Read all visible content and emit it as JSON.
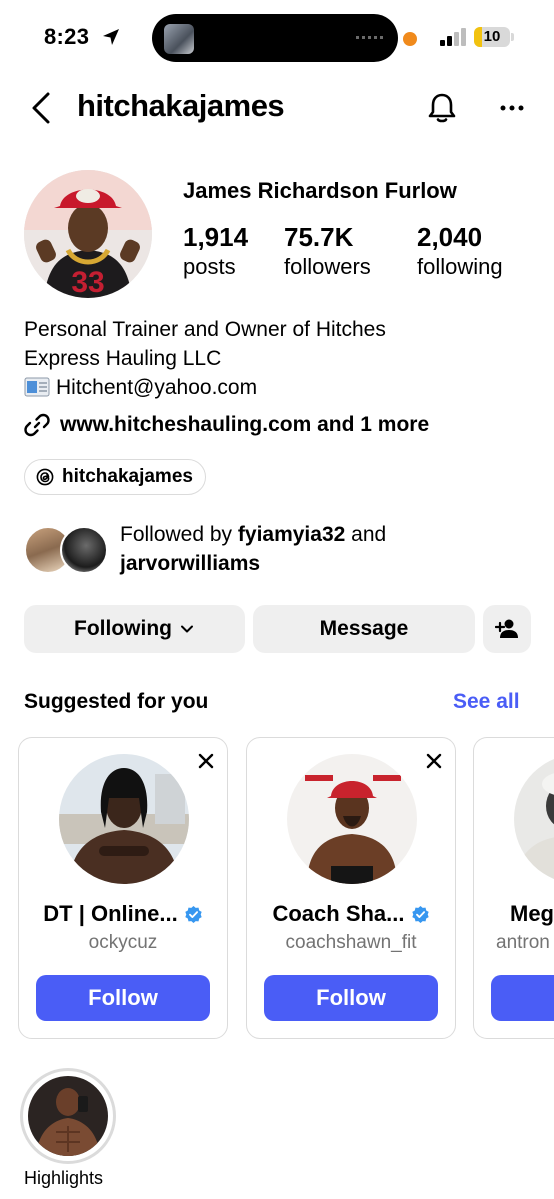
{
  "status_bar": {
    "time": "8:23",
    "battery": "10",
    "battery_fraction": 0.1
  },
  "header": {
    "username": "hitchakajames",
    "back_icon": "chevron-left-icon",
    "bell_icon": "bell-icon",
    "more_icon": "more-horizontal-icon"
  },
  "profile": {
    "full_name": "James Richardson Furlow",
    "stats": {
      "posts": {
        "value": "1,914",
        "label": "posts"
      },
      "followers": {
        "value": "75.7K",
        "label": "followers"
      },
      "following": {
        "value": "2,040",
        "label": "following"
      }
    },
    "bio_line1": "Personal Trainer and Owner of Hitches",
    "bio_line2": "Express Hauling LLC",
    "email": "Hitchent@yahoo.com",
    "link": "www.hitcheshauling.com and 1 more",
    "threads_handle": "hitchakajames",
    "followed_by_prefix": "Followed by ",
    "followed_by_user1": "fyiamyia32",
    "followed_by_and": " and",
    "followed_by_user2": "jarvorwilliams"
  },
  "actions": {
    "following": "Following",
    "message": "Message"
  },
  "suggested": {
    "title": "Suggested for you",
    "see_all": "See all",
    "cards": [
      {
        "name": "DT | Online...",
        "handle": "ockycuz",
        "follow": "Follow",
        "verified": true
      },
      {
        "name": "Coach Sha...",
        "handle": "coachshawn_fit",
        "follow": "Follow",
        "verified": true
      },
      {
        "name": "Meg",
        "handle": "antron",
        "follow": "Fo",
        "verified": false
      }
    ]
  },
  "highlights": {
    "label": "Highlights"
  },
  "colors": {
    "accent": "#4a5df6",
    "verified": "#3797f0",
    "button_bg": "#efefef",
    "secondary_text": "#737373"
  }
}
